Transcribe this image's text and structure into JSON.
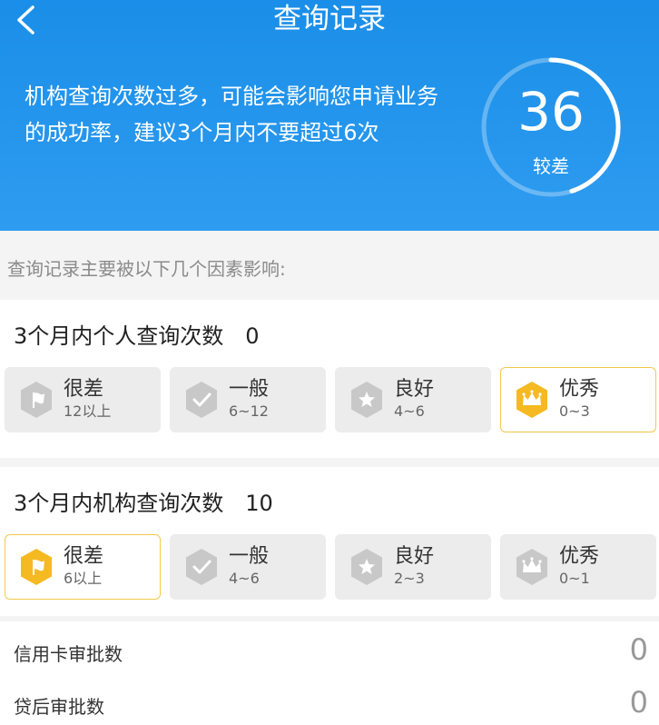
{
  "header": {
    "title": "查询记录",
    "warning": "机构查询次数过多，可能会影响您申请业务的成功率，建议3个月内不要超过6次",
    "score": "36",
    "score_level": "较差"
  },
  "intro": "查询记录主要被以下几个因素影响:",
  "personal": {
    "title": "3个月内个人查询次数",
    "count": "0",
    "tiles": [
      {
        "level": "很差",
        "range": "12以上",
        "icon": "flag-icon",
        "active": false
      },
      {
        "level": "一般",
        "range": "6~12",
        "icon": "check-icon",
        "active": false
      },
      {
        "level": "良好",
        "range": "4~6",
        "icon": "star-icon",
        "active": false
      },
      {
        "level": "优秀",
        "range": "0~3",
        "icon": "crown-icon",
        "active": true
      }
    ]
  },
  "institution": {
    "title": "3个月内机构查询次数",
    "count": "10",
    "tiles": [
      {
        "level": "很差",
        "range": "6以上",
        "icon": "flag-icon",
        "active": true
      },
      {
        "level": "一般",
        "range": "4~6",
        "icon": "check-icon",
        "active": false
      },
      {
        "level": "良好",
        "range": "2~3",
        "icon": "star-icon",
        "active": false
      },
      {
        "level": "优秀",
        "range": "0~1",
        "icon": "crown-icon",
        "active": false
      }
    ]
  },
  "stats": [
    {
      "label": "信用卡审批数",
      "value": "0"
    },
    {
      "label": "贷后审批数",
      "value": "0"
    }
  ],
  "colors": {
    "header": "#1a8ee8",
    "active_icon": "#f5b921",
    "inactive_icon": "#c8c8c8"
  }
}
